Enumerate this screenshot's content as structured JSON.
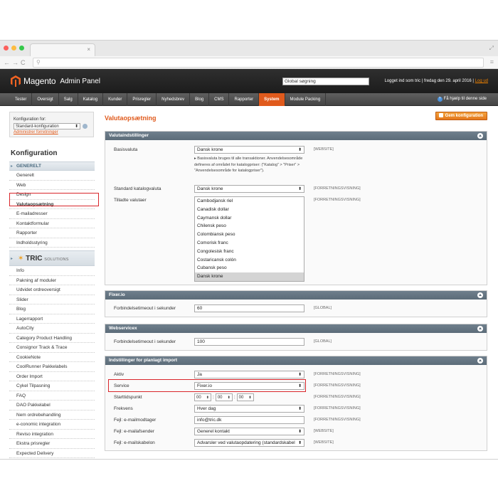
{
  "header": {
    "logo_text": "Magento",
    "logo_sub": "Admin Panel",
    "global_search": "Global søgning",
    "user_info": "Logget ind som tric | fredag den 29. april 2016 |",
    "logout": "Log ud"
  },
  "nav": {
    "items": [
      "Tester",
      "Oversigt",
      "Salg",
      "Katalog",
      "Kunder",
      "Prisregler",
      "Nyhedsbrev",
      "Blog",
      "CMS",
      "Rapporter",
      "System",
      "Module Packing"
    ],
    "active": "System",
    "help": "Få hjælp til denne side"
  },
  "sidebar": {
    "scope_label": "Konfiguration for:",
    "scope_value": "Standard-konfiguration",
    "manage_stores": "Administrer forretninger",
    "title": "Konfiguration",
    "section_general": "GENERELT",
    "general_items": [
      "Generelt",
      "Web",
      "Design",
      "Valutaopsætning",
      "E-mailadresser",
      "Kontaktformular",
      "Rapporter",
      "Indholdsstyring"
    ],
    "active_item": "Valutaopsætning",
    "tric_logo": "TRIC",
    "tric_sub": "SOLUTIONS",
    "tric_items": [
      "Info",
      "Pakning af moduler",
      "Udvidet ordreoversigt",
      "Slider",
      "Blog",
      "Lagerrapport",
      "AutoCity",
      "Category Product Handling",
      "Consignor Track & Trace",
      "CookieNote",
      "CoolRunner Pakkelabels",
      "Order Import",
      "Cykel Tilpasning",
      "FAQ",
      "DAO Pakkelabel",
      "Nem ordrebehandling",
      "e-conomic integration",
      "Reviso integration",
      "Ekstra prisregler",
      "Expected Delivery"
    ]
  },
  "main": {
    "title": "Valutaopsætning",
    "save_button": "Gem konfiguration",
    "sections": {
      "currency": {
        "header": "Valutaindstillinger",
        "base_label": "Basisvaluta",
        "base_value": "Dansk krone",
        "base_scope": "[WEBSITE]",
        "base_note": "Basisvaluta bruges til alle transaktioner. Anvendelsesområde defineres af området for katalogpriser: (\"Katalog\" > \"Priser\" > \"Anvendelsesområde for katalogpriser\").",
        "default_label": "Standard katalogvaluta",
        "default_value": "Dansk krone",
        "default_scope": "[FORRETNINGSVISNING]",
        "allowed_label": "Tilladte valutaer",
        "allowed_scope": "[FORRETNINGSVISNING]",
        "allowed_options": [
          "Cambodjansk riel",
          "Canadisk dollar",
          "Caymansk dollar",
          "Chilensk peso",
          "Colombiansk peso",
          "Comorisk franc",
          "Congolesisk franc",
          "Costaricansk colón",
          "Cubansk peso",
          "Dansk krone"
        ],
        "allowed_selected": "Dansk krone"
      },
      "fixer": {
        "header": "Fixer.io",
        "timeout_label": "Forbindelsetimeout i sekunder",
        "timeout_value": "60",
        "timeout_scope": "[GLOBAL]"
      },
      "webservicex": {
        "header": "Webservicex",
        "timeout_label": "Forbindelsetimeout i sekunder",
        "timeout_value": "100",
        "timeout_scope": "[GLOBAL]"
      },
      "scheduled": {
        "header": "Indstillinger for planlagt import",
        "active_label": "Aktiv",
        "active_value": "Ja",
        "active_scope": "[FORRETNINGSVISNING]",
        "service_label": "Service",
        "service_value": "Fixer.io",
        "service_scope": "[FORRETNINGSVISNING]",
        "start_label": "Starttidspunkt",
        "start_h": "00",
        "start_m": "00",
        "start_s": "00",
        "start_scope": "[FORRETNINGSVISNING]",
        "freq_label": "Frekvens",
        "freq_value": "Hver dag",
        "freq_scope": "[FORRETNINGSVISNING]",
        "err_recipient_label": "Fejl: e-mailmodtager",
        "err_recipient_value": "info@tric.dk",
        "err_recipient_scope": "[FORRETNINGSVISNING]",
        "err_sender_label": "Fejl: e-mailafsender",
        "err_sender_value": "Generel kontakt",
        "err_sender_scope": "[WEBSITE]",
        "err_template_label": "Fejl: e-mailskabelon",
        "err_template_value": "Advarsler ved valutaopdatering (standardskabel",
        "err_template_scope": "[WEBSITE]"
      }
    }
  },
  "colors": {
    "accent": "#e05a1c",
    "highlight": "#d9262b",
    "section_header": "#5c6c79"
  }
}
